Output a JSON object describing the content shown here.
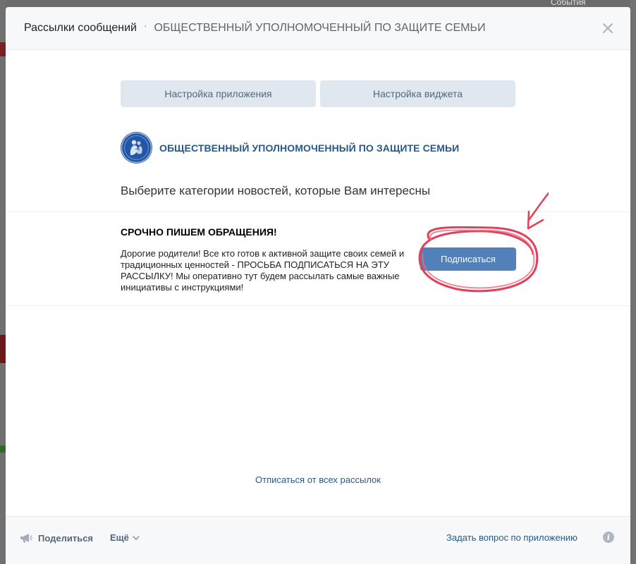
{
  "background": {
    "events_label": "События"
  },
  "header": {
    "title": "Рассылки сообщений",
    "separator": "·",
    "subtitle": "ОБЩЕСТВЕННЫЙ УПОЛНОМОЧЕННЫЙ ПО ЗАЩИТЕ СЕМЬИ"
  },
  "tabs": [
    {
      "label": "Настройка приложения"
    },
    {
      "label": "Настройка виджета"
    }
  ],
  "group": {
    "name": "ОБЩЕСТВЕННЫЙ УПОЛНОМОЧЕННЫЙ ПО ЗАЩИТЕ СЕМЬИ",
    "logo_color": "#2a5aa8"
  },
  "prompt": "Выберите категории новостей, которые Вам интересны",
  "mailing": {
    "title": "СРОЧНО ПИШЕМ ОБРАЩЕНИЯ!",
    "description": "Дорогие родители! Все кто готов к активной защите своих семей и традиционных ценностей - ПРОСЬБА ПОДПИСАТЬСЯ НА ЭТУ РАССЫЛКУ! Мы оперативно тут будем рассылать самые важные инициативы с инструкциями!",
    "subscribe_label": "Подписаться"
  },
  "unsubscribe_all": "Отписаться от всех рассылок",
  "footer": {
    "share_label": "Поделиться",
    "more_label": "Ещё",
    "ask_label": "Задать вопрос по приложению",
    "info_symbol": "i"
  },
  "colors": {
    "accent": "#5181b8",
    "link": "#2a5885",
    "annotation": "#e0405a"
  }
}
